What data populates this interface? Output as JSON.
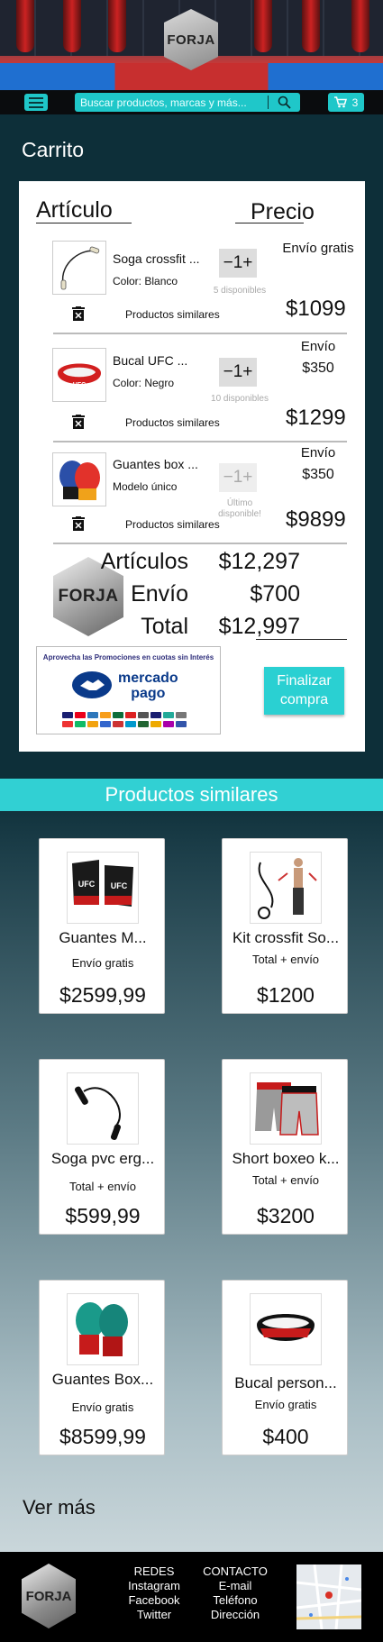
{
  "header": {
    "brand": "FORJA",
    "search_placeholder": "Buscar productos, marcas y más...",
    "cart_count": "3"
  },
  "cart": {
    "title": "Carrito",
    "col_item": "Artículo",
    "col_price": "Precio",
    "items": [
      {
        "name": "Soga crossfit ...",
        "variant": "Color: Blanco",
        "qty_minus": "−",
        "qty": "1",
        "qty_plus": "+",
        "stock": "5 disponibles",
        "ship_label": "Envío gratis",
        "ship_cost": "",
        "price": "$1099",
        "similar": "Productos similares"
      },
      {
        "name": "Bucal UFC ...",
        "variant": "Color: Negro",
        "qty_minus": "−",
        "qty": "1",
        "qty_plus": "+",
        "stock": "10 disponibles",
        "ship_label": "Envío",
        "ship_cost": "$350",
        "price": "$1299",
        "similar": "Productos similares"
      },
      {
        "name": "Guantes box ...",
        "variant": "Modelo único",
        "qty_minus": "−",
        "qty": "1",
        "qty_plus": "+",
        "stock": "Último disponible!",
        "ship_label": "Envío",
        "ship_cost": "$350",
        "price": "$9899",
        "similar": "Productos similares"
      }
    ],
    "totals": {
      "items_label": "Artículos",
      "items_value": "$12,297",
      "ship_label": "Envío",
      "ship_value": "$700",
      "total_label": "Total",
      "total_value": "$12,997"
    },
    "promo_text": "Aprovecha las Promociones en cuotas sin Interés",
    "promo_brand_1": "mercado",
    "promo_brand_2": "pago",
    "checkout_1": "Finalizar",
    "checkout_2": "compra"
  },
  "similar": {
    "title": "Productos similares",
    "products": [
      {
        "name": "Guantes M...",
        "ship": "Envío gratis",
        "price": "$2599,99"
      },
      {
        "name": "Kit crossfit So...",
        "ship": "Total + envío",
        "price": "$1200"
      },
      {
        "name": "Soga pvc erg...",
        "ship": "Total + envío",
        "price": "$599,99"
      },
      {
        "name": "Short boxeo k...",
        "ship": "Total + envío",
        "price": "$3200"
      },
      {
        "name": "Guantes Box...",
        "ship": "Envío gratis",
        "price": "$8599,99"
      },
      {
        "name": "Bucal person...",
        "ship": "Envío gratis",
        "price": "$400"
      }
    ],
    "more": "Ver más"
  },
  "footer": {
    "redes_title": "REDES",
    "redes": [
      "Instagram",
      "Facebook",
      "Twitter"
    ],
    "contacto_title": "CONTACTO",
    "contacto": [
      "E-mail",
      "Teléfono",
      "Dirección"
    ]
  },
  "colors": {
    "accent": "#1fc7c9",
    "dark_bg": "#0d2f39"
  }
}
